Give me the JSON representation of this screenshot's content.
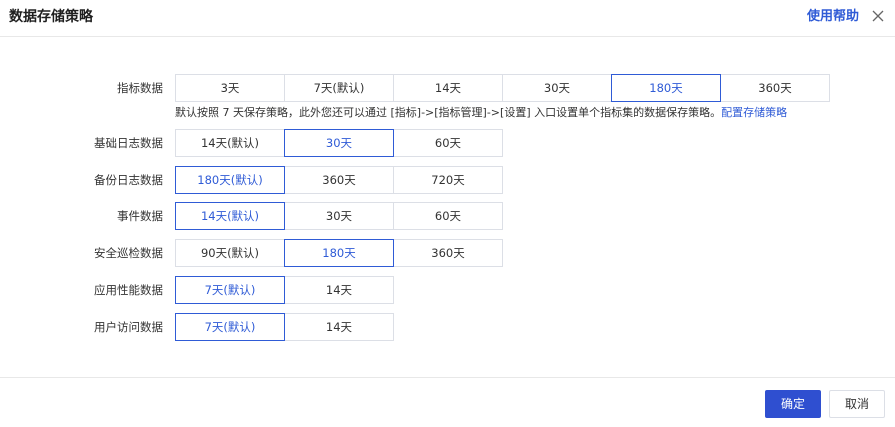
{
  "dialog": {
    "title": "数据存储策略",
    "help_link": "使用帮助",
    "close_icon": "close-icon"
  },
  "rows": {
    "metrics": {
      "label": "指标数据",
      "options": [
        "3天",
        "7天(默认)",
        "14天",
        "30天",
        "180天",
        "360天"
      ],
      "selected": "180天"
    },
    "hint": {
      "text": "默认按照 7 天保存策略，此外您还可以通过 [指标]->[指标管理]->[设置] 入口设置单个指标集的数据保存策略。",
      "link": "配置存储策略"
    },
    "base_log": {
      "label": "基础日志数据",
      "options": [
        "14天(默认)",
        "30天",
        "60天"
      ],
      "selected": "30天"
    },
    "backup_log": {
      "label": "备份日志数据",
      "options": [
        "180天(默认)",
        "360天",
        "720天"
      ],
      "selected": "180天(默认)"
    },
    "event": {
      "label": "事件数据",
      "options": [
        "14天(默认)",
        "30天",
        "60天"
      ],
      "selected": "14天(默认)"
    },
    "security": {
      "label": "安全巡检数据",
      "options": [
        "90天(默认)",
        "180天",
        "360天"
      ],
      "selected": "180天"
    },
    "apm": {
      "label": "应用性能数据",
      "options": [
        "7天(默认)",
        "14天"
      ],
      "selected": "7天(默认)"
    },
    "rum": {
      "label": "用户访问数据",
      "options": [
        "7天(默认)",
        "14天"
      ],
      "selected": "7天(默认)"
    }
  },
  "footer": {
    "ok_label": "确定",
    "cancel_label": "取消"
  },
  "colors": {
    "accent": "#2f5bd6",
    "primary_button": "#2f4fd0",
    "border": "#dcdfe6"
  }
}
